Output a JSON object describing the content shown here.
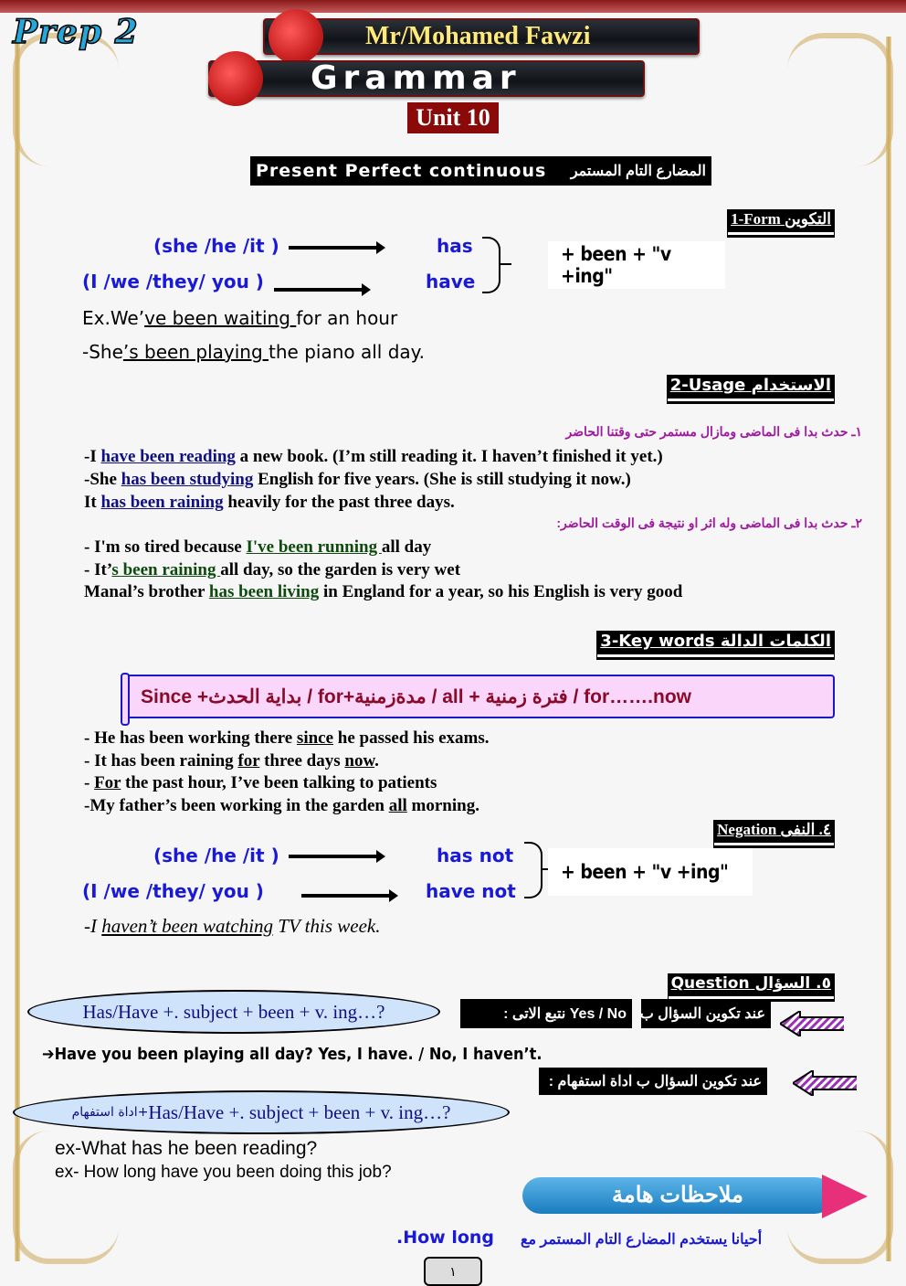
{
  "header": {
    "level": "Prep 2",
    "author": "Mr/Mohamed Fawzi",
    "subject": "Grammar",
    "unit": "Unit 10"
  },
  "title": {
    "english": "Present Perfect continuous",
    "arabic": "المضارع التام المستمر"
  },
  "form": {
    "heading_en": "1-Form",
    "heading_ar": "التكوين",
    "subject_row1": "(she /he /it )",
    "subject_row2": "(I  /we /they/ you )",
    "aux_row1": "has",
    "aux_row2": "have",
    "formula": "+  been + \"v +ing\"",
    "examples": [
      {
        "pre": "Ex.We’",
        "u": "ve been waiting ",
        "post": "for an hour"
      },
      {
        "pre": "-She",
        "u": "’s been playing ",
        "post": "the piano all day."
      }
    ]
  },
  "usage": {
    "heading_en": "2-Usage",
    "heading_ar": "الاستخدام",
    "rule1": "١ـ حدث بدا فى الماضى ومازال مستمر حتى وقتنا الحاضر",
    "rule1_examples": [
      {
        "pre": "-I ",
        "u": "have been reading",
        "post": " a new book. (I’m still reading it. I haven’t finished it yet.)"
      },
      {
        "pre": "-She ",
        "u": "has been studying",
        "post": " English for five years. (She is still studying it now.)"
      },
      {
        "pre": "It ",
        "u": "has been raining",
        "post": " heavily for the past three days."
      }
    ],
    "rule2": "٢ـ حدث بدا فى الماضى وله اثر او نتيجة فى الوقت الحاضر:",
    "rule2_examples": [
      {
        "pre": "- I'm so tired because ",
        "u": "I've been running ",
        "post": "all day"
      },
      {
        "pre": "- It’",
        "u": "s been raining ",
        "post": "all day, so the garden is very wet"
      },
      {
        "pre": "Manal’s brother ",
        "u": "has been living",
        "post": " in England for a year, so his English is very good"
      }
    ]
  },
  "keywords": {
    "heading_en": "3-Key words",
    "heading_ar": "الكلمات الدالة",
    "scroll_text": "Since +بداية الحدث / for+مدةزمنية / all + فترة زمنية / for…….now",
    "examples": [
      {
        "pre": "- He has been working there ",
        "u": "since",
        "post": " he passed his exams."
      },
      {
        "pre": "- It has been raining ",
        "u": "for",
        "mid": " three days ",
        "u2": "now",
        "post": "."
      },
      {
        "pre": "- ",
        "u": "For",
        "post": " the past hour, I’ve been talking to patients"
      },
      {
        "pre": "-My father’s been working in the garden ",
        "u": "all",
        "post": " morning."
      }
    ]
  },
  "negation": {
    "heading_en": "Negation",
    "heading_ar": "٤. النفى",
    "subject_row1": "(she /he /it )",
    "subject_row2": "(I  /we /they/ you )",
    "aux_row1": "has  not",
    "aux_row2": "have not",
    "formula": "+  been + \"v +ing\"",
    "example": {
      "pre": "-I ",
      "u": "haven’t been watching",
      "post": " TV this week."
    }
  },
  "question": {
    "heading_en": "Question",
    "heading_ar": "٥. السؤال",
    "yesno_label": "عند تكوين السؤال ب",
    "yesno_tag": "Yes / No نتبع الاتى :",
    "yesno_formula": "Has/Have +. subject + been + v. ing…?",
    "yesno_example": "➔Have you been playing all day? Yes, I have. / No, I haven’t.",
    "wh_label": "عند تكوين السؤال ب  اداة استفهام :",
    "wh_formula_ar": "اداة استفهام+",
    "wh_formula": "Has/Have +. subject + been + v. ing…?",
    "wh_examples": [
      "ex-What has he been reading?",
      "ex- How long have you been doing this job?"
    ]
  },
  "notes": {
    "banner": "ملاحظات هامة",
    "note_ar": "أحيانا يستخدم المضارع التام المستمر مع",
    "note_en": "How   long."
  },
  "page_number": "١"
}
